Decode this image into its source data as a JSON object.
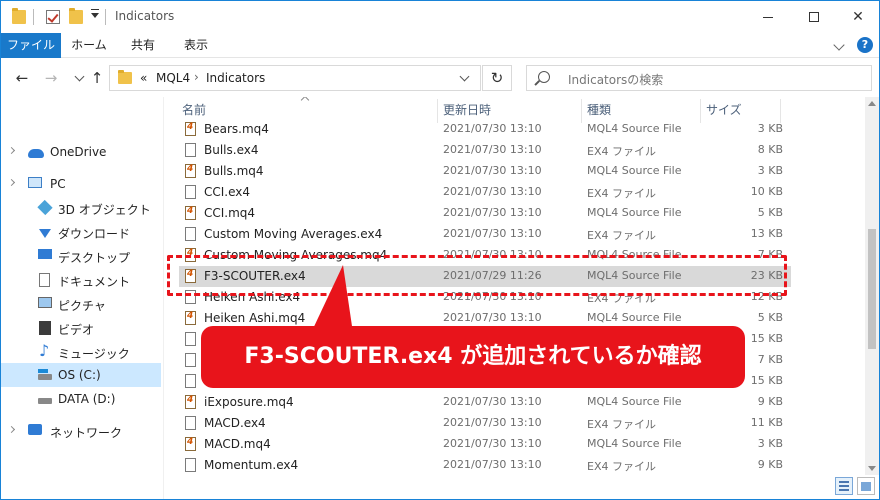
{
  "window": {
    "title": "Indicators"
  },
  "ribbon": {
    "tabs": [
      {
        "label": "ファイル",
        "active": true
      },
      {
        "label": "ホーム"
      },
      {
        "label": "共有"
      },
      {
        "label": "表示"
      }
    ],
    "help": "?"
  },
  "nav": {
    "address_root": "«",
    "address_parts": [
      "MQL4",
      "Indicators"
    ],
    "separator": "›",
    "search_placeholder": "Indicatorsの検索"
  },
  "sidebar": {
    "items": [
      {
        "label": "OneDrive",
        "icon": "cloud-icon"
      },
      {
        "label": "PC",
        "icon": "pc-icon"
      },
      {
        "label": "3D オブジェクト",
        "icon": "cube-icon"
      },
      {
        "label": "ダウンロード",
        "icon": "download-icon"
      },
      {
        "label": "デスクトップ",
        "icon": "desktop-icon"
      },
      {
        "label": "ドキュメント",
        "icon": "document-icon"
      },
      {
        "label": "ピクチャ",
        "icon": "picture-icon"
      },
      {
        "label": "ビデオ",
        "icon": "video-icon"
      },
      {
        "label": "ミュージック",
        "icon": "music-icon"
      },
      {
        "label": "OS (C:)",
        "icon": "drive-icon",
        "selected": true
      },
      {
        "label": "DATA (D:)",
        "icon": "drive-icon"
      },
      {
        "label": "ネットワーク",
        "icon": "network-icon"
      }
    ]
  },
  "columns": {
    "name": "名前",
    "date": "更新日時",
    "type": "種類",
    "size": "サイズ"
  },
  "files": [
    {
      "name": "Bears.mq4",
      "date": "2021/07/30 13:10",
      "type": "MQL4 Source File",
      "size": "3 KB",
      "kind": "mq4"
    },
    {
      "name": "Bulls.ex4",
      "date": "2021/07/30 13:10",
      "type": "EX4 ファイル",
      "size": "8 KB",
      "kind": "ex4"
    },
    {
      "name": "Bulls.mq4",
      "date": "2021/07/30 13:10",
      "type": "MQL4 Source File",
      "size": "3 KB",
      "kind": "mq4"
    },
    {
      "name": "CCI.ex4",
      "date": "2021/07/30 13:10",
      "type": "EX4 ファイル",
      "size": "10 KB",
      "kind": "ex4"
    },
    {
      "name": "CCI.mq4",
      "date": "2021/07/30 13:10",
      "type": "MQL4 Source File",
      "size": "5 KB",
      "kind": "mq4"
    },
    {
      "name": "Custom Moving Averages.ex4",
      "date": "2021/07/30 13:10",
      "type": "EX4 ファイル",
      "size": "13 KB",
      "kind": "ex4"
    },
    {
      "name": "Custom Moving Averages.mq4",
      "date": "2021/07/30 13:10",
      "type": "MQL4 Source File",
      "size": "7 KB",
      "kind": "mq4"
    },
    {
      "name": "F3-SCOUTER.ex4",
      "date": "2021/07/29 11:26",
      "type": "MQL4 Source File",
      "size": "23 KB",
      "kind": "mq4",
      "selected": true
    },
    {
      "name": "Heiken Ashi.ex4",
      "date": "2021/07/30 13:10",
      "type": "EX4 ファイル",
      "size": "12 KB",
      "kind": "ex4"
    },
    {
      "name": "Heiken Ashi.mq4",
      "date": "2021/07/30 13:10",
      "type": "MQL4 Source File",
      "size": "5 KB",
      "kind": "mq4"
    },
    {
      "name": "",
      "date": "",
      "type": "",
      "size": "15 KB",
      "kind": "ex4"
    },
    {
      "name": "",
      "date": "",
      "type": "",
      "size": "7 KB",
      "kind": "ex4"
    },
    {
      "name": "",
      "date": "",
      "type": "",
      "size": "15 KB",
      "kind": "ex4"
    },
    {
      "name": "iExposure.mq4",
      "date": "2021/07/30 13:10",
      "type": "MQL4 Source File",
      "size": "9 KB",
      "kind": "mq4"
    },
    {
      "name": "MACD.ex4",
      "date": "2021/07/30 13:10",
      "type": "EX4 ファイル",
      "size": "11 KB",
      "kind": "ex4"
    },
    {
      "name": "MACD.mq4",
      "date": "2021/07/30 13:10",
      "type": "MQL4 Source File",
      "size": "3 KB",
      "kind": "mq4"
    },
    {
      "name": "Momentum.ex4",
      "date": "2021/07/30 13:10",
      "type": "EX4 ファイル",
      "size": "9 KB",
      "kind": "ex4"
    }
  ],
  "annotation": {
    "text": "F3-SCOUTER.ex4 が追加されているか確認",
    "color": "#e8141b"
  }
}
